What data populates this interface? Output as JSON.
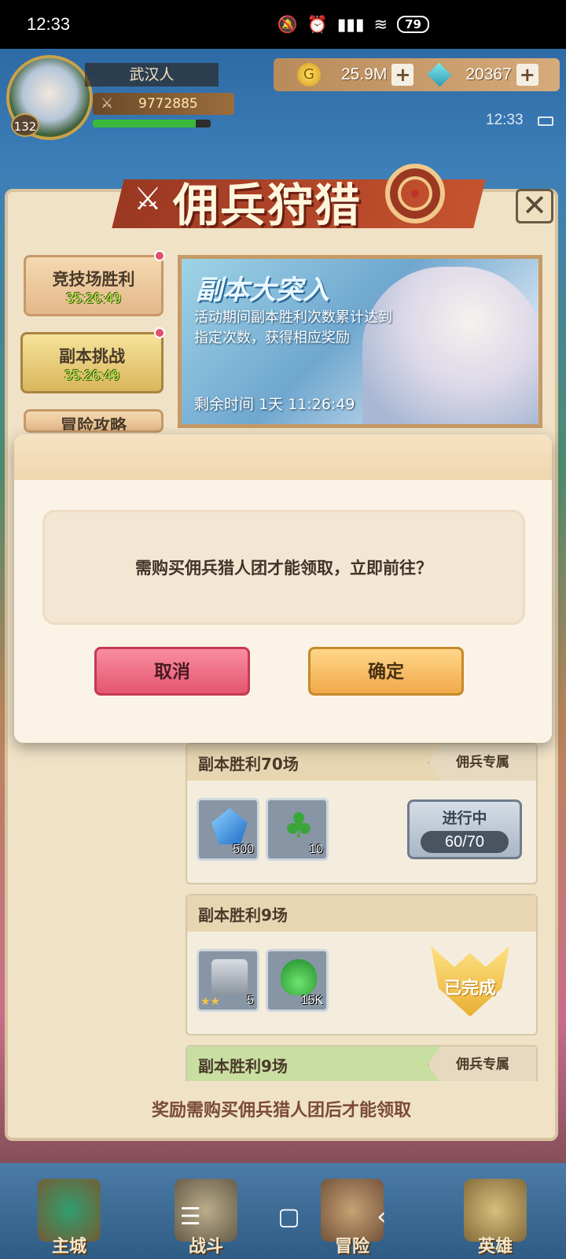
{
  "status_bar": {
    "time": "12:33",
    "battery": "79",
    "icons": [
      "mute-icon",
      "alarm-icon",
      "signal-icon",
      "wifi-icon",
      "battery-icon"
    ]
  },
  "player": {
    "name": "武汉人",
    "level": "132",
    "power": "9772885",
    "xp_fraction": 0.87
  },
  "resources": {
    "gold": "25.9M",
    "gems": "20367"
  },
  "clock": {
    "time": "12:33"
  },
  "event": {
    "title": "佣兵狩猎"
  },
  "side_tabs": [
    {
      "label": "竞技场胜利",
      "timer": "35:26:49"
    },
    {
      "label": "副本挑战",
      "timer": "35:26:49"
    },
    {
      "label": "冒险攻略",
      "timer": ""
    }
  ],
  "banner": {
    "title": "副本大突入",
    "description": "活动期间副本胜利次数累计达到指定次数，获得相应奖励",
    "remaining_label": "剩余时间",
    "remaining_value": "1天 11:26:49"
  },
  "tasks": [
    {
      "title": "副本胜利70场",
      "tag": "佣兵专属",
      "rewards": [
        {
          "icon": "crystal-icon",
          "qty": "500"
        },
        {
          "icon": "clover-icon",
          "qty": "10"
        }
      ],
      "status_label": "进行中",
      "progress": "60/70"
    },
    {
      "title": "副本胜利9场",
      "tag": "",
      "rewards": [
        {
          "icon": "chest-icon",
          "qty": "5"
        },
        {
          "icon": "potion-icon",
          "qty": "15K"
        }
      ],
      "status_label": "已完成"
    },
    {
      "title": "副本胜利9场",
      "tag": "佣兵专属"
    }
  ],
  "footer_note": "奖励需购买佣兵猎人团后才能领取",
  "dialog": {
    "message": "需购买佣兵猎人团才能领取，立即前往？",
    "cancel_label": "取消",
    "confirm_label": "确定"
  },
  "bottom_nav": [
    {
      "label": "主城"
    },
    {
      "label": "战斗"
    },
    {
      "label": "冒险"
    },
    {
      "label": "英雄"
    }
  ],
  "system_nav": {
    "menu": "☰",
    "home": "▢",
    "back": "‹"
  },
  "colors": {
    "panel": "#f0e2c6",
    "cancel": "#e4566f",
    "confirm": "#f2a94a",
    "timer_green": "#b8f04a"
  }
}
